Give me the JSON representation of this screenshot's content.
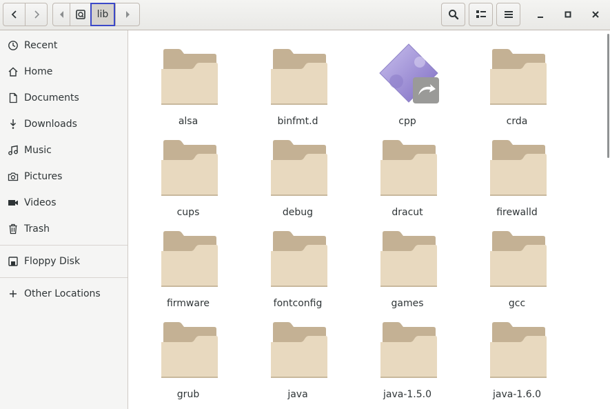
{
  "header": {
    "back_icon": "chevron-left-icon",
    "forward_icon": "chevron-right-icon",
    "path_current": "lib",
    "search_icon": "search-icon",
    "view_icon": "list-view-icon",
    "menu_icon": "hamburger-menu-icon",
    "minimize_icon": "minimize-icon",
    "maximize_icon": "maximize-icon",
    "close_icon": "close-icon"
  },
  "sidebar": {
    "items": [
      {
        "label": "Recent",
        "icon": "clock-icon"
      },
      {
        "label": "Home",
        "icon": "home-icon"
      },
      {
        "label": "Documents",
        "icon": "document-icon"
      },
      {
        "label": "Downloads",
        "icon": "download-icon"
      },
      {
        "label": "Music",
        "icon": "music-icon"
      },
      {
        "label": "Pictures",
        "icon": "camera-icon"
      },
      {
        "label": "Videos",
        "icon": "video-icon"
      },
      {
        "label": "Trash",
        "icon": "trash-icon"
      },
      {
        "label": "Floppy Disk",
        "icon": "floppy-disk-icon"
      },
      {
        "label": "Other Locations",
        "icon": "plus-icon"
      }
    ]
  },
  "files": [
    {
      "name": "alsa",
      "type": "folder"
    },
    {
      "name": "binfmt.d",
      "type": "folder"
    },
    {
      "name": "cpp",
      "type": "symlink-executable"
    },
    {
      "name": "crda",
      "type": "folder"
    },
    {
      "name": "cups",
      "type": "folder"
    },
    {
      "name": "debug",
      "type": "folder"
    },
    {
      "name": "dracut",
      "type": "folder"
    },
    {
      "name": "firewalld",
      "type": "folder"
    },
    {
      "name": "firmware",
      "type": "folder"
    },
    {
      "name": "fontconfig",
      "type": "folder"
    },
    {
      "name": "games",
      "type": "folder"
    },
    {
      "name": "gcc",
      "type": "folder"
    },
    {
      "name": "grub",
      "type": "folder"
    },
    {
      "name": "java",
      "type": "folder"
    },
    {
      "name": "java-1.5.0",
      "type": "folder"
    },
    {
      "name": "java-1.6.0",
      "type": "folder"
    }
  ],
  "colors": {
    "folder_body": "#e8d9bf",
    "folder_tab": "#c4b194",
    "path_focus": "#3b48c8"
  }
}
